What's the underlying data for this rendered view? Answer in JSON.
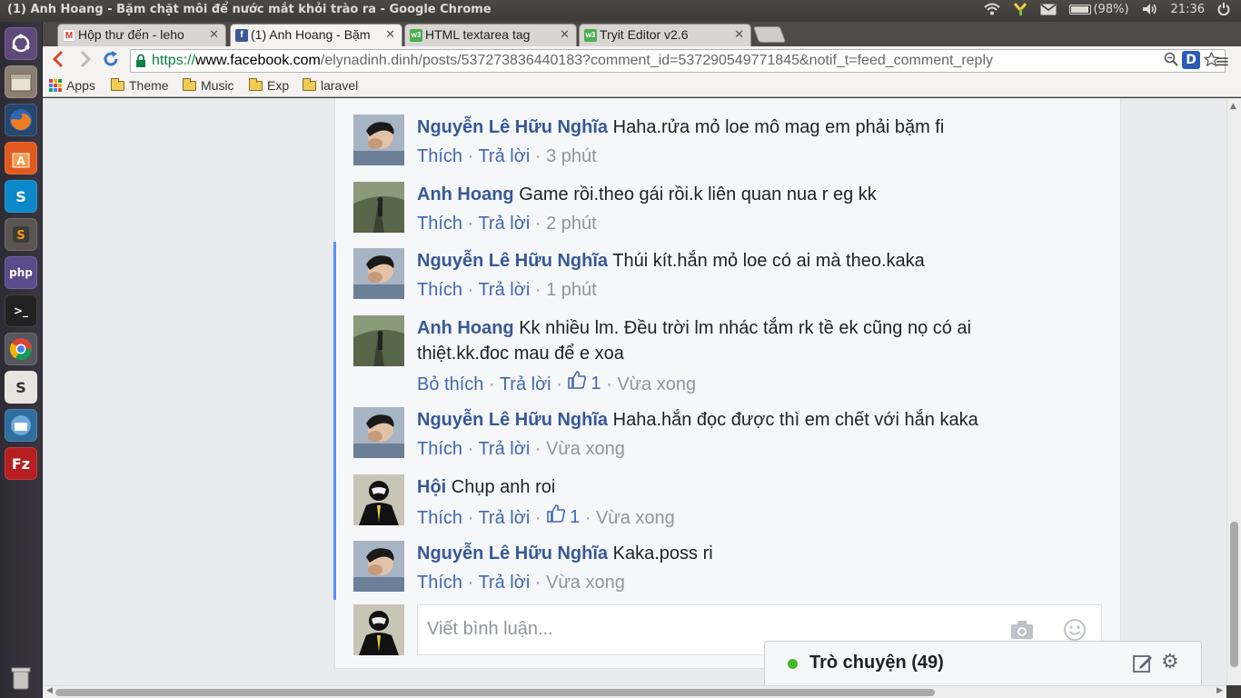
{
  "window": {
    "title": "(1) Anh Hoang - Bặm chặt môi để nước mắt khỏi trào ra - Google Chrome",
    "battery": "(98%)",
    "clock": "21:36"
  },
  "tabs": [
    {
      "label": "Hộp thư đến - leho",
      "icon": "gmail-icon",
      "active": false
    },
    {
      "label": "(1) Anh Hoang - Bặm",
      "icon": "facebook-icon",
      "active": true
    },
    {
      "label": "HTML textarea tag",
      "icon": "w3schools-icon",
      "active": false
    },
    {
      "label": "Tryit Editor v2.6",
      "icon": "w3schools-icon",
      "active": false
    }
  ],
  "address": {
    "scheme": "https://",
    "host": "www.facebook.com",
    "path": "/elynadinh.dinh/posts/537273836440183?comment_id=537290549771845&notif_t=feed_comment_reply"
  },
  "bookmarks": [
    "Apps",
    "Theme",
    "Music",
    "Exp",
    "laravel"
  ],
  "comments": [
    {
      "author": "Nguyễn Lê Hữu Nghĩa",
      "text": "Haha.rửa mỏ loe mô mag em phải bặm fi",
      "like": "Thích",
      "reply": "Trả lời",
      "likes": "",
      "time": "3 phút",
      "avatar": "guy"
    },
    {
      "author": "Anh Hoang",
      "text": "Game rồi.theo gái rồi.k liên quan nua r eg kk",
      "like": "Thích",
      "reply": "Trả lời",
      "likes": "",
      "time": "2 phút",
      "avatar": "path"
    },
    {
      "author": "Nguyễn Lê Hữu Nghĩa",
      "text": "Thúi kít.hắn mỏ loe có ai mà theo.kaka",
      "like": "Thích",
      "reply": "Trả lời",
      "likes": "",
      "time": "1 phút",
      "avatar": "guy"
    },
    {
      "author": "Anh Hoang",
      "text": "Kk nhiều lm. Đều trời lm nhác tắm rk tề ek cũng nọ có ai thiệt.kk.đoc mau để e xoa",
      "like": "Bỏ thích",
      "reply": "Trả lời",
      "likes": "1",
      "time": "Vừa xong",
      "avatar": "path"
    },
    {
      "author": "Nguyễn Lê Hữu Nghĩa",
      "text": "Haha.hắn đọc được thì em chết với hắn kaka",
      "like": "Thích",
      "reply": "Trả lời",
      "likes": "",
      "time": "Vừa xong",
      "avatar": "guy"
    },
    {
      "author": "Hội",
      "text": "Chụp anh roi",
      "like": "Thích",
      "reply": "Trả lời",
      "likes": "1",
      "time": "Vừa xong",
      "avatar": "mask"
    },
    {
      "author": "Nguyễn Lê Hữu Nghĩa",
      "text": "Kaka.poss ri",
      "like": "Thích",
      "reply": "Trả lời",
      "likes": "",
      "time": "Vừa xong",
      "avatar": "guy"
    }
  ],
  "composer": {
    "placeholder": "Viết bình luận..."
  },
  "chat": {
    "label": "Trò chuyện (49)"
  },
  "colors": {
    "link": "#365899",
    "action": "#4267b2",
    "meta": "#90949c",
    "online": "#42b72a",
    "thread": "#5890ff"
  }
}
